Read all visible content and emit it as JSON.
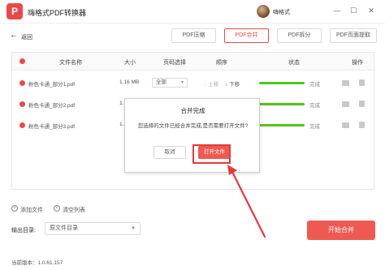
{
  "app": {
    "title": "嗨格式PDF转换器",
    "logo_glyph": "P",
    "username": "嗨格式"
  },
  "window": {
    "min_glyph": "—",
    "max_glyph": "☐",
    "close_glyph": "✕"
  },
  "nav": {
    "back_glyph": "←",
    "back_label": "返回"
  },
  "tabs": [
    {
      "label": "PDF压缩",
      "active": false
    },
    {
      "label": "PDF合并",
      "active": true
    },
    {
      "label": "PDF拆分",
      "active": false
    },
    {
      "label": "PDF页面提取",
      "active": false
    }
  ],
  "table": {
    "headers": {
      "name": "文件名称",
      "size": "大小",
      "page": "页码选择",
      "order": "顺序",
      "status": "状态",
      "action": "操作"
    },
    "rows": [
      {
        "name": "粉色卡通_部分1.pdf",
        "size": "1.16 MB",
        "page": "全部",
        "up": "上移",
        "down": "下移",
        "progress": 1.0,
        "status": "完成"
      },
      {
        "name": "粉色卡通_部分2.pdf",
        "size": "1.16 MB",
        "page": "全部",
        "up": "上移",
        "down": "下移",
        "progress": 1.0,
        "status": "完成"
      },
      {
        "name": "粉色卡通_部分3.pdf",
        "size": "1.16 MB",
        "page": "全部",
        "up": "上移",
        "down": "下移",
        "progress": 1.0,
        "status": "完成"
      }
    ]
  },
  "bottom": {
    "add_file": "添加文件",
    "clear_list": "清空列表",
    "output_label": "输出目录:",
    "output_value": "原文件目录",
    "start_button": "开始合并",
    "version": "当前版本：1.0.61.157"
  },
  "modal": {
    "title": "合并完成",
    "message": "您选择的文件已经合并完成,是否需要打开文件?",
    "cancel": "取消",
    "open": "打开文件"
  },
  "colors": {
    "accent": "#ee5a52",
    "progress": "#52c41a",
    "annotation": "#e13b3b"
  }
}
